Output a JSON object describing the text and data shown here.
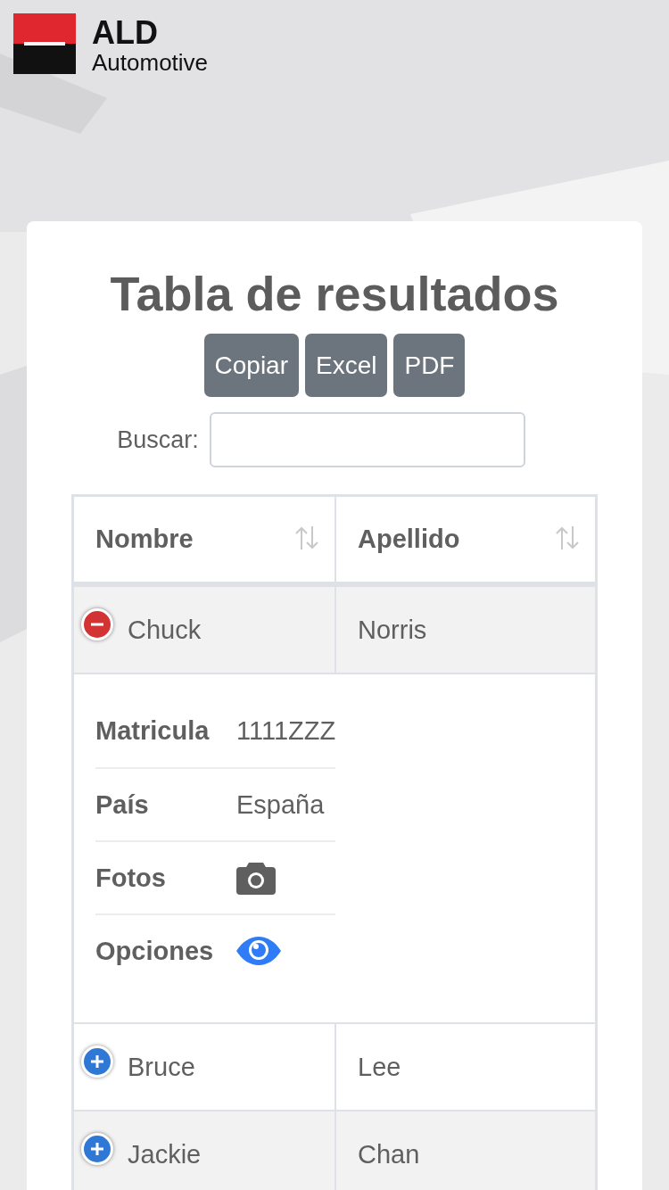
{
  "logo": {
    "line_1": "ALD",
    "line_2": "Automotive"
  },
  "title": "Tabla de resultados",
  "buttons": [
    "Copiar",
    "Excel",
    "PDF"
  ],
  "search": {
    "label": "Buscar:"
  },
  "table": {
    "columns": [
      "Nombre",
      "Apellido"
    ],
    "rows": [
      {
        "cells": [
          "Chuck",
          "Norris"
        ],
        "expanded": true,
        "details": [
          {
            "label": "Matricula",
            "kind": "text",
            "value": "1111ZZZ"
          },
          {
            "label": "País",
            "kind": "text",
            "value": "España"
          },
          {
            "label": "Fotos",
            "kind": "camera"
          },
          {
            "label": "Opciones",
            "kind": "eye"
          }
        ]
      },
      {
        "cells": [
          "Bruce",
          "Lee"
        ],
        "expanded": false
      },
      {
        "cells": [
          "Jackie",
          "Chan"
        ],
        "expanded": false
      }
    ]
  }
}
